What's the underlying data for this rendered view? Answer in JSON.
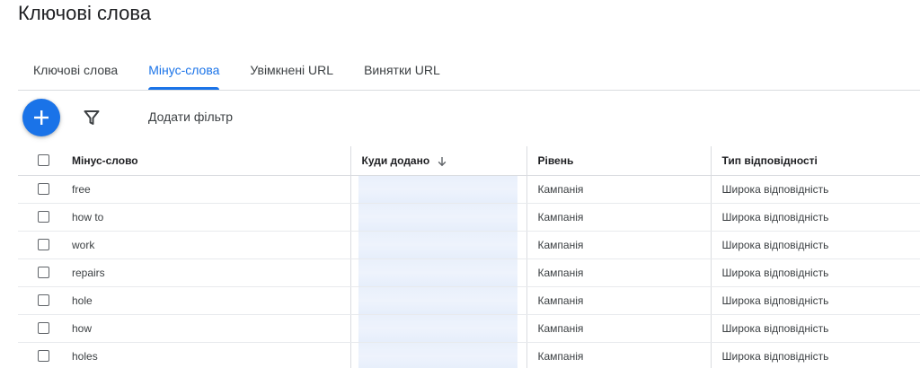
{
  "page": {
    "title": "Ключові слова"
  },
  "tabs": [
    {
      "label": "Ключові слова",
      "active": false
    },
    {
      "label": "Мінус-слова",
      "active": true
    },
    {
      "label": "Увімкнені URL",
      "active": false
    },
    {
      "label": "Винятки URL",
      "active": false
    }
  ],
  "toolbar": {
    "add_filter_label": "Додати фільтр"
  },
  "table": {
    "columns": {
      "keyword": "Мінус-слово",
      "added_to": "Куди додано",
      "level": "Рівень",
      "match_type": "Тип відповідності"
    },
    "rows": [
      {
        "keyword": "free",
        "added_to": "",
        "level": "Кампанія",
        "match_type": "Широка відповідність"
      },
      {
        "keyword": "how to",
        "added_to": "",
        "level": "Кампанія",
        "match_type": "Широка відповідність"
      },
      {
        "keyword": "work",
        "added_to": "",
        "level": "Кампанія",
        "match_type": "Широка відповідність"
      },
      {
        "keyword": "repairs",
        "added_to": "",
        "level": "Кампанія",
        "match_type": "Широка відповідність"
      },
      {
        "keyword": "hole",
        "added_to": "",
        "level": "Кампанія",
        "match_type": "Широка відповідність"
      },
      {
        "keyword": "how",
        "added_to": "",
        "level": "Кампанія",
        "match_type": "Широка відповідність"
      },
      {
        "keyword": "holes",
        "added_to": "",
        "level": "Кампанія",
        "match_type": "Широка відповідність"
      }
    ]
  },
  "colors": {
    "accent": "#1a73e8",
    "text": "#202124",
    "divider": "#dadce0"
  }
}
